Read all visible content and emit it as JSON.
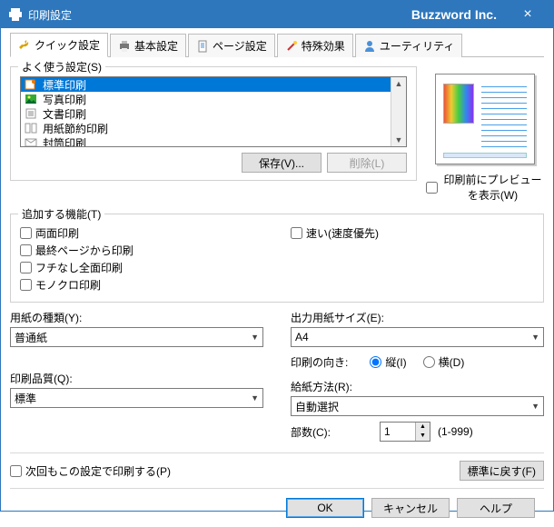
{
  "window": {
    "title": "印刷設定",
    "brand": "Buzzword Inc."
  },
  "tabs": [
    {
      "label": "クイック設定",
      "active": true
    },
    {
      "label": "基本設定"
    },
    {
      "label": "ページ設定"
    },
    {
      "label": "特殊効果"
    },
    {
      "label": "ユーティリティ"
    }
  ],
  "presets": {
    "legend": "よく使う設定(S)",
    "items": [
      "標準印刷",
      "写真印刷",
      "文書印刷",
      "用紙節約印刷",
      "封筒印刷"
    ],
    "selected_index": 0,
    "save_label": "保存(V)...",
    "delete_label": "削除(L)"
  },
  "preview": {
    "checkbox_label": "印刷前にプレビューを表示(W)"
  },
  "addfunc": {
    "legend": "追加する機能(T)",
    "left": [
      "両面印刷",
      "最終ページから印刷",
      "フチなし全面印刷",
      "モノクロ印刷"
    ],
    "right": [
      "速い(速度優先)"
    ]
  },
  "left": {
    "media_label": "用紙の種類(Y):",
    "media_value": "普通紙",
    "quality_label": "印刷品質(Q):",
    "quality_value": "標準"
  },
  "right": {
    "size_label": "出力用紙サイズ(E):",
    "size_value": "A4",
    "orient_label": "印刷の向き:",
    "orient_portrait": "縦(I)",
    "orient_landscape": "横(D)",
    "feed_label": "給紙方法(R):",
    "feed_value": "自動選択",
    "copies_label": "部数(C):",
    "copies_value": "1",
    "copies_range": "(1-999)"
  },
  "bottom": {
    "remember_label": "次回もこの設定で印刷する(P)",
    "defaults_label": "標準に戻す(F)"
  },
  "footer": {
    "ok": "OK",
    "cancel": "キャンセル",
    "help": "ヘルプ"
  }
}
